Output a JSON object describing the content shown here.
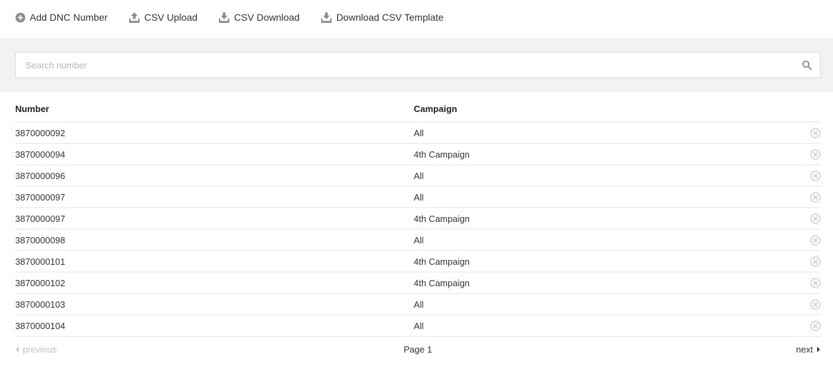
{
  "toolbar": {
    "add_label": "Add DNC Number",
    "upload_label": "CSV Upload",
    "download_label": "CSV Download",
    "template_label": "Download CSV Template"
  },
  "search": {
    "placeholder": "Search number",
    "value": ""
  },
  "table": {
    "headers": {
      "number": "Number",
      "campaign": "Campaign"
    },
    "rows": [
      {
        "number": "3870000092",
        "campaign": "All"
      },
      {
        "number": "3870000094",
        "campaign": "4th Campaign"
      },
      {
        "number": "3870000096",
        "campaign": "All"
      },
      {
        "number": "3870000097",
        "campaign": "All"
      },
      {
        "number": "3870000097",
        "campaign": "4th Campaign"
      },
      {
        "number": "3870000098",
        "campaign": "All"
      },
      {
        "number": "3870000101",
        "campaign": "4th Campaign"
      },
      {
        "number": "3870000102",
        "campaign": "4th Campaign"
      },
      {
        "number": "3870000103",
        "campaign": "All"
      },
      {
        "number": "3870000104",
        "campaign": "All"
      }
    ]
  },
  "pagination": {
    "previous": "previous",
    "page": "Page 1",
    "next": "next"
  },
  "colors": {
    "icon_gray": "#888888",
    "remove_icon": "#d0d0d0",
    "disabled_text": "#c4c4c4",
    "search_band": "#f2f2f2"
  },
  "icons": {
    "add": "plus-circle-icon",
    "upload": "upload-tray-icon",
    "download": "download-tray-icon",
    "search": "magnifier-icon",
    "remove": "close-circle-icon",
    "prev": "caret-left-icon",
    "next": "caret-right-icon"
  }
}
